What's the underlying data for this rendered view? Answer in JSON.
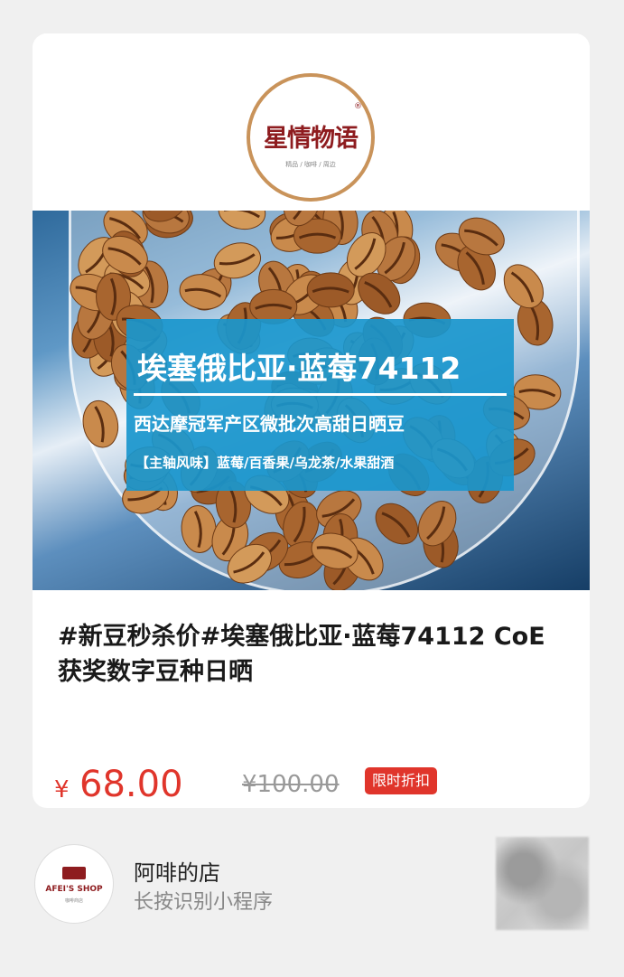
{
  "product": {
    "image": {
      "logo_text": "星情物语",
      "logo_sub": "精品 / 咖啡 / 周边",
      "logo_reg": "®",
      "banner_title": "埃塞俄比亚·蓝莓74112",
      "banner_sub": "西达摩冠军产区微批次高甜日晒豆",
      "banner_notes": "【主轴风味】蓝莓/百香果/乌龙茶/水果甜酒"
    },
    "title": "#新豆秒杀价#埃塞俄比亚·蓝莓74112 CoE获奖数字豆种日晒",
    "price_currency": "¥",
    "price_now": "68.00",
    "price_old": "¥100.00",
    "badge": "限时折扣"
  },
  "shop": {
    "avatar_text": "AFEI'S SHOP",
    "avatar_sub": "咖啡商店",
    "name": "阿啡的店",
    "hint": "长按识别小程序"
  },
  "colors": {
    "price": "#e0352b",
    "banner": "#1996cd",
    "logo": "#8e1c1f"
  }
}
